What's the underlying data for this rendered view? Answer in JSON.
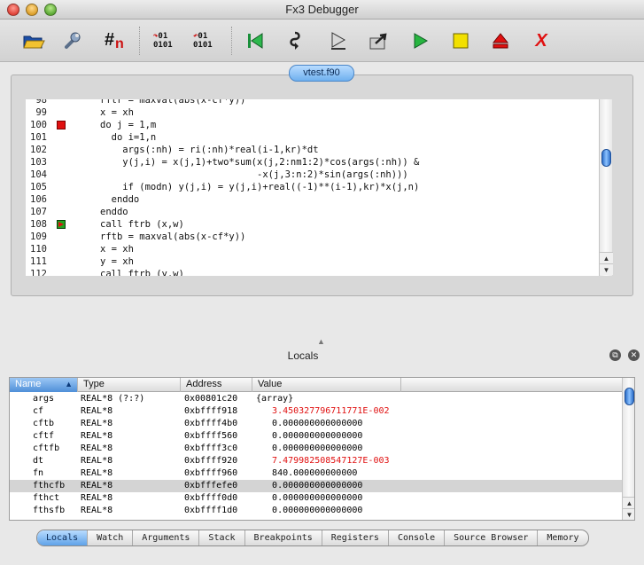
{
  "window": {
    "title": "Fx3 Debugger"
  },
  "toolbar": {
    "buttons": [
      {
        "name": "open-folder",
        "icon": "folder-open-icon"
      },
      {
        "name": "settings",
        "icon": "wrench-icon"
      },
      {
        "name": "line-numbers",
        "icon": "hash-n-icon"
      },
      {
        "name": "step-binary-in",
        "icon": "binary-step-in-icon"
      },
      {
        "name": "step-binary-over",
        "icon": "binary-step-over-icon"
      },
      {
        "name": "restart",
        "icon": "restart-icon"
      },
      {
        "name": "step-into",
        "icon": "step-into-icon"
      },
      {
        "name": "step-over",
        "icon": "step-over-icon"
      },
      {
        "name": "step-out",
        "icon": "step-out-icon"
      },
      {
        "name": "run",
        "icon": "play-icon"
      },
      {
        "name": "stop",
        "icon": "stop-square-icon"
      },
      {
        "name": "eject",
        "icon": "eject-icon"
      },
      {
        "name": "kill",
        "icon": "x-kill-icon"
      }
    ],
    "hash_label": "#",
    "hash_sub": "n",
    "bin_label": "01",
    "bin_label2": "0101",
    "kill_label": "X"
  },
  "editor": {
    "file_tab": "vtest.f90",
    "lines": [
      {
        "num": "98",
        "text": "rftr = maxval(abs(x-cf*y))",
        "marker": ""
      },
      {
        "num": "99",
        "text": "x = xh",
        "marker": ""
      },
      {
        "num": "100",
        "text": "do j = 1,m",
        "marker": "breakpoint"
      },
      {
        "num": "101",
        "text": "  do i=1,n",
        "marker": ""
      },
      {
        "num": "102",
        "text": "    args(:nh) = ri(:nh)*real(i-1,kr)*dt",
        "marker": ""
      },
      {
        "num": "103",
        "text": "    y(j,i) = x(j,1)+two*sum(x(j,2:nm1:2)*cos(args(:nh)) &",
        "marker": ""
      },
      {
        "num": "104",
        "text": "                            -x(j,3:n:2)*sin(args(:nh)))",
        "marker": ""
      },
      {
        "num": "105",
        "text": "    if (modn) y(j,i) = y(j,i)+real((-1)**(i-1),kr)*x(j,n)",
        "marker": ""
      },
      {
        "num": "106",
        "text": "  enddo",
        "marker": ""
      },
      {
        "num": "107",
        "text": "enddo",
        "marker": ""
      },
      {
        "num": "108",
        "text": "call ftrb (x,w)",
        "marker": "current"
      },
      {
        "num": "109",
        "text": "rftb = maxval(abs(x-cf*y))",
        "marker": ""
      },
      {
        "num": "110",
        "text": "x = xh",
        "marker": ""
      },
      {
        "num": "111",
        "text": "y = xh",
        "marker": ""
      },
      {
        "num": "112",
        "text": "call ftrb (y,w)",
        "marker": ""
      }
    ]
  },
  "locals": {
    "title": "Locals",
    "columns": [
      "Name",
      "Type",
      "Address",
      "Value"
    ],
    "rows": [
      {
        "name": "args",
        "type": "REAL*8 (?:?)",
        "address": "0x00801c20",
        "value": "{array}",
        "changed": false,
        "selected": false
      },
      {
        "name": "cf",
        "type": "REAL*8",
        "address": "0xbffff918",
        "value": "   3.450327796711771E-002",
        "changed": true,
        "selected": false
      },
      {
        "name": "cftb",
        "type": "REAL*8",
        "address": "0xbffff4b0",
        "value": "   0.000000000000000",
        "changed": false,
        "selected": false
      },
      {
        "name": "cftf",
        "type": "REAL*8",
        "address": "0xbffff560",
        "value": "   0.000000000000000",
        "changed": false,
        "selected": false
      },
      {
        "name": "cftfb",
        "type": "REAL*8",
        "address": "0xbffff3c0",
        "value": "   0.000000000000000",
        "changed": false,
        "selected": false
      },
      {
        "name": "dt",
        "type": "REAL*8",
        "address": "0xbffff920",
        "value": "   7.479982508547127E-003",
        "changed": true,
        "selected": false
      },
      {
        "name": "fn",
        "type": "REAL*8",
        "address": "0xbffff960",
        "value": "   840.000000000000",
        "changed": false,
        "selected": false
      },
      {
        "name": "fthcfb",
        "type": "REAL*8",
        "address": "0xbfffefe0",
        "value": "   0.000000000000000",
        "changed": false,
        "selected": true
      },
      {
        "name": "fthct",
        "type": "REAL*8",
        "address": "0xbffff0d0",
        "value": "   0.000000000000000",
        "changed": false,
        "selected": false
      },
      {
        "name": "fthsfb",
        "type": "REAL*8",
        "address": "0xbffff1d0",
        "value": "   0.000000000000000",
        "changed": false,
        "selected": false
      }
    ]
  },
  "bottom_tabs": [
    "Locals",
    "Watch",
    "Arguments",
    "Stack",
    "Breakpoints",
    "Registers",
    "Console",
    "Source Browser",
    "Memory"
  ],
  "active_tab": "Locals",
  "colors": {
    "accent": "#4f8fd8",
    "changed_value": "#e01010",
    "selection": "#d4d4d4"
  }
}
